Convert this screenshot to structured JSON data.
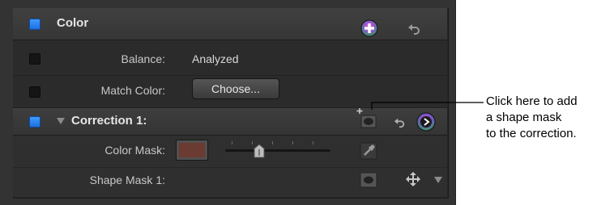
{
  "header": {
    "title": "Color"
  },
  "rows": {
    "balance": {
      "label": "Balance:",
      "value": "Analyzed"
    },
    "match": {
      "label": "Match Color:",
      "button": "Choose..."
    },
    "correction": {
      "title": "Correction 1:"
    },
    "color_mask": {
      "label": "Color Mask:",
      "swatch_color": "#6b3a30"
    },
    "shape_mask": {
      "label": "Shape Mask 1:"
    }
  },
  "callout": {
    "line1": "Click here to add",
    "line2": "a shape mask",
    "line3": "to the correction."
  },
  "colors": {
    "accent_checkbox": "#2f86f4",
    "panel_bg": "#262626"
  }
}
